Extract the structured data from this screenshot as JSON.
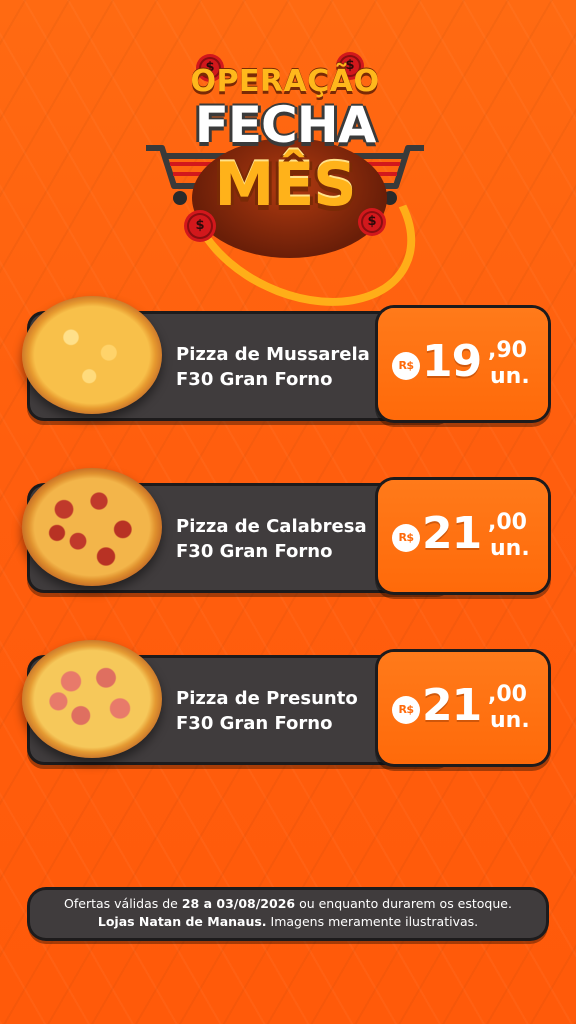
{
  "logo": {
    "line1": "OPERAÇÃO",
    "line2": "FECHA",
    "line3": "MÊS",
    "coin_symbol": "$"
  },
  "products": [
    {
      "name_line1": "Pizza de Mussarela",
      "name_line2": "F30 Gran Forno",
      "currency": "R$",
      "price_int": "19",
      "price_cents": ",90",
      "unit": "un.",
      "image": "pizza-mussarela"
    },
    {
      "name_line1": "Pizza de Calabresa",
      "name_line2": "F30 Gran Forno",
      "currency": "R$",
      "price_int": "21",
      "price_cents": ",00",
      "unit": "un.",
      "image": "pizza-calabresa"
    },
    {
      "name_line1": "Pizza de Presunto",
      "name_line2": "F30 Gran Forno",
      "currency": "R$",
      "price_int": "21",
      "price_cents": ",00",
      "unit": "un.",
      "image": "pizza-presunto"
    }
  ],
  "footer": {
    "line1_prefix": "Ofertas válidas de ",
    "line1_dates": "28 a 03/08/2026",
    "line1_suffix": " ou enquanto durarem os estoque.",
    "line2_bold": "Lojas Natan de Manaus.",
    "line2_rest": " Imagens meramente ilustrativas."
  },
  "colors": {
    "background": "#ff5e0e",
    "panel": "#403c3d",
    "price_box": "#ff6a0a",
    "logo_gold": "#ffb21a"
  }
}
